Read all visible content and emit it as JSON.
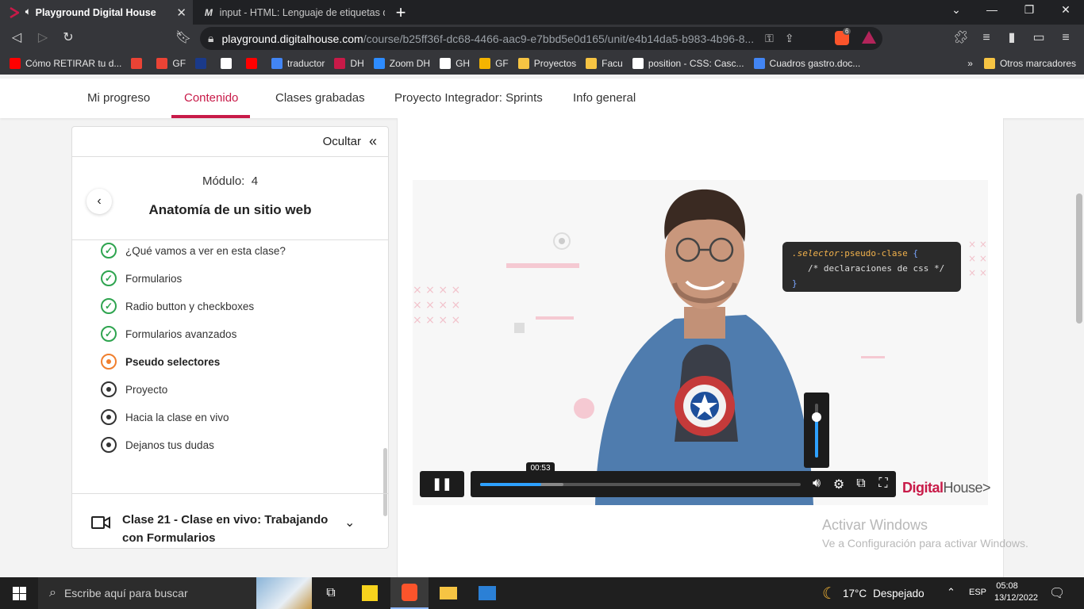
{
  "browser": {
    "tabs": [
      {
        "title": "Playground Digital House",
        "active": true
      },
      {
        "title": "input - HTML: Lenguaje de etiquetas d",
        "active": false
      }
    ],
    "url_host": "playground.digitalhouse.com",
    "url_path": "/course/b25ff36f-dc68-4466-aac9-e7bbd5e0d165/unit/e4b14da5-b983-4b96-8...",
    "brave_shield_count": "6",
    "bookmarks": [
      {
        "label": "Cómo RETIRAR tu d...",
        "icon": "youtube-icon",
        "color": "#ff0000"
      },
      {
        "label": "",
        "icon": "gmail-icon",
        "color": "#ea4335"
      },
      {
        "label": "GF",
        "icon": "gmail-icon",
        "color": "#ea4335"
      },
      {
        "label": "",
        "icon": "square-icon",
        "color": "#1a3a8a"
      },
      {
        "label": "",
        "icon": "uec-icon",
        "color": "#ffffff"
      },
      {
        "label": "",
        "icon": "youtube-icon",
        "color": "#ff0000"
      },
      {
        "label": "traductor",
        "icon": "google-icon",
        "color": "#4285f4"
      },
      {
        "label": "DH",
        "icon": "dh-icon",
        "color": "#c81a48"
      },
      {
        "label": "Zoom DH",
        "icon": "zoom-icon",
        "color": "#2d8cff"
      },
      {
        "label": "GH",
        "icon": "github-icon",
        "color": "#ffffff"
      },
      {
        "label": "GF",
        "icon": "gf-icon",
        "color": "#f4b400"
      },
      {
        "label": "Proyectos",
        "icon": "folder-icon",
        "color": "#f6c443"
      },
      {
        "label": "Facu",
        "icon": "folder-icon",
        "color": "#f6c443"
      },
      {
        "label": "position - CSS: Casc...",
        "icon": "mdn-icon",
        "color": "#ffffff"
      },
      {
        "label": "Cuadros gastro.doc...",
        "icon": "docs-icon",
        "color": "#4285f4"
      }
    ],
    "more_bookmarks": "Otros marcadores"
  },
  "site_nav": {
    "items": [
      "Mi progreso",
      "Contenido",
      "Clases grabadas",
      "Proyecto Integrador: Sprints",
      "Info general"
    ],
    "active_index": 1
  },
  "sidebar": {
    "hide_label": "Ocultar",
    "module_label": "Módulo:",
    "module_number": "4",
    "module_title": "Anatomía de un sitio web",
    "lessons": [
      {
        "label": "¿Qué vamos a ver en esta clase?",
        "status": "done"
      },
      {
        "label": "Formularios",
        "status": "done"
      },
      {
        "label": "Radio button y checkboxes",
        "status": "done"
      },
      {
        "label": "Formularios avanzados",
        "status": "done"
      },
      {
        "label": "Pseudo selectores",
        "status": "current"
      },
      {
        "label": "Proyecto",
        "status": "pending"
      },
      {
        "label": "Hacia la clase en vivo",
        "status": "pending"
      },
      {
        "label": "Dejanos tus dudas",
        "status": "pending"
      }
    ],
    "next_class_title": "Clase 21 - Clase en vivo: Trabajando con Formularios"
  },
  "video": {
    "code_line1_selector": ".selector",
    "code_line1_pseudo": ":pseudo-clase",
    "code_line1_brace": " {",
    "code_line2": "/* declaraciones de css */",
    "code_line3": "}",
    "current_time": "00:53",
    "played_fraction": 0.19,
    "buffered_fraction": 0.26,
    "volume_fraction": 0.75,
    "logo_digital": "Digital",
    "logo_house": "House",
    "logo_arrow": ">"
  },
  "watermark": {
    "line1": "Activar Windows",
    "line2": "Ve a Configuración para activar Windows."
  },
  "taskbar": {
    "search_placeholder": "Escribe aquí para buscar",
    "temperature": "17°C",
    "weather": "Despejado",
    "language": "ESP",
    "time": "05:08",
    "date": "13/12/2022"
  },
  "colors": {
    "accent": "#c81a48",
    "done": "#2ea44f",
    "current": "#f07f2e",
    "progress": "#2ea1ff"
  }
}
